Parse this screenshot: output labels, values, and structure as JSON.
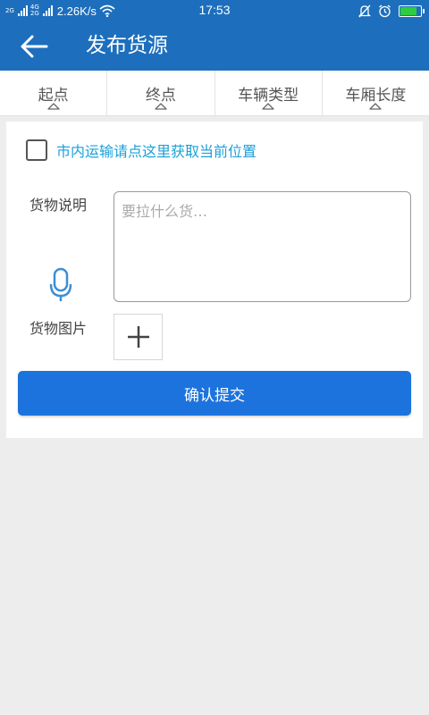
{
  "status_bar": {
    "net_top": "2G",
    "net_mid": "4G",
    "net_low": "2G",
    "speed": "2.26K/s",
    "time": "17:53",
    "battery_level_percent": 85
  },
  "header": {
    "title": "发布货源"
  },
  "filters": [
    {
      "label": "起点"
    },
    {
      "label": "终点"
    },
    {
      "label": "车辆类型"
    },
    {
      "label": "车厢长度"
    }
  ],
  "form": {
    "location_text": "市内运输请点这里获取当前位置",
    "location_checked": false,
    "description_label": "货物说明",
    "description_placeholder": "要拉什么货…",
    "description_value": "",
    "image_label": "货物图片",
    "submit_label": "确认提交"
  },
  "colors": {
    "primary": "#1d6fbd",
    "button": "#1d73de",
    "link": "#1aa0d8",
    "background": "#ededed"
  }
}
